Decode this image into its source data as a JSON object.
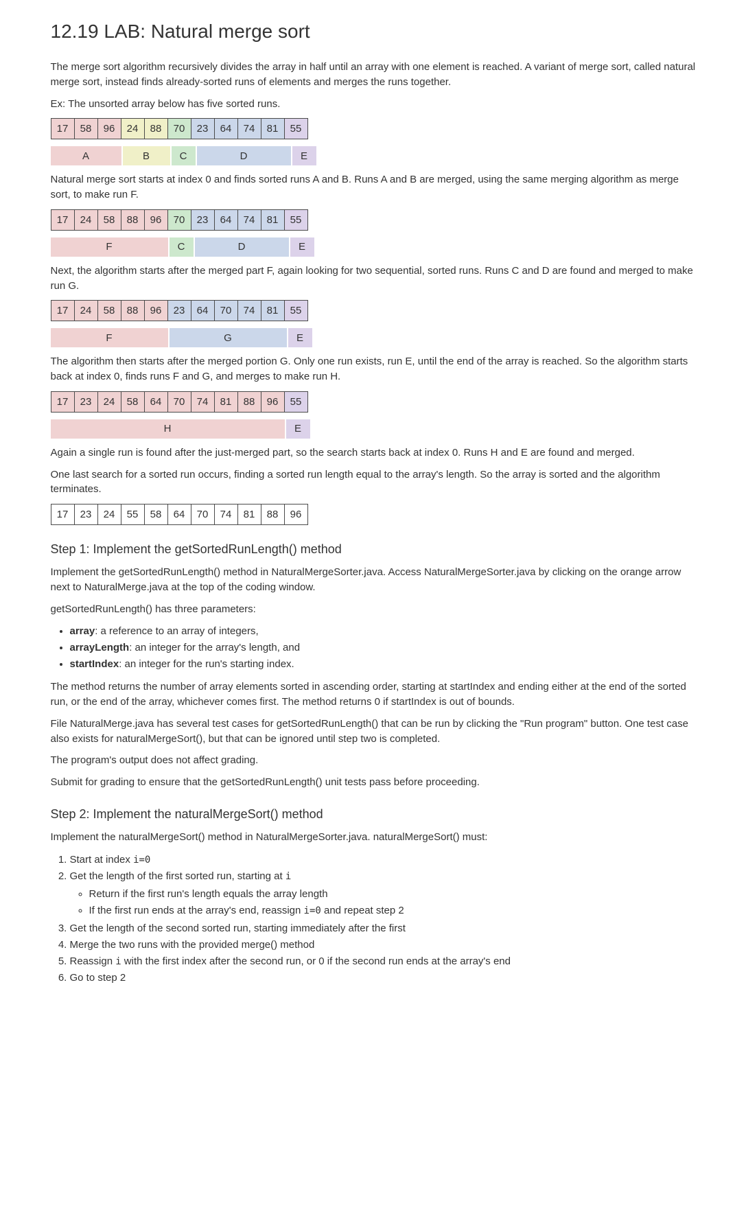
{
  "title": "12.19 LAB: Natural merge sort",
  "intro": "The merge sort algorithm recursively divides the array in half until an array with one element is reached. A variant of merge sort, called natural merge sort, instead finds already-sorted runs of elements and merges the runs together.",
  "ex_line": "Ex: The unsorted array below has five sorted runs.",
  "arr1": {
    "vals": [
      17,
      58,
      96,
      24,
      88,
      70,
      23,
      64,
      74,
      81,
      55
    ]
  },
  "labels1": [
    {
      "letter": "A",
      "span": 3,
      "color": "c-pink"
    },
    {
      "letter": "B",
      "span": 2,
      "color": "c-yellow"
    },
    {
      "letter": "C",
      "span": 1,
      "color": "c-green"
    },
    {
      "letter": "D",
      "span": 4,
      "color": "c-blue"
    },
    {
      "letter": "E",
      "span": 1,
      "color": "c-purple"
    }
  ],
  "p2": "Natural merge sort starts at index 0 and finds sorted runs A and B. Runs A and B are merged, using the same merging algorithm as merge sort, to make run F.",
  "arr2": {
    "vals": [
      17,
      24,
      58,
      88,
      96,
      70,
      23,
      64,
      74,
      81,
      55
    ]
  },
  "labels2": [
    {
      "letter": "F",
      "span": 5,
      "color": "c-pink"
    },
    {
      "letter": "C",
      "span": 1,
      "color": "c-green"
    },
    {
      "letter": "D",
      "span": 4,
      "color": "c-blue"
    },
    {
      "letter": "E",
      "span": 1,
      "color": "c-purple"
    }
  ],
  "p3": "Next, the algorithm starts after the merged part F, again looking for two sequential, sorted runs. Runs C and D are found and merged to make run G.",
  "arr3": {
    "vals": [
      17,
      24,
      58,
      88,
      96,
      23,
      64,
      70,
      74,
      81,
      55
    ]
  },
  "labels3": [
    {
      "letter": "F",
      "span": 5,
      "color": "c-pink"
    },
    {
      "letter": "G",
      "span": 5,
      "color": "c-blue"
    },
    {
      "letter": "E",
      "span": 1,
      "color": "c-purple"
    }
  ],
  "p4": "The algorithm then starts after the merged portion G. Only one run exists, run E, until the end of the array is reached. So the algorithm starts back at index 0, finds runs F and G, and merges to make run H.",
  "arr4": {
    "vals": [
      17,
      23,
      24,
      58,
      64,
      70,
      74,
      81,
      88,
      96,
      55
    ]
  },
  "labels4": [
    {
      "letter": "H",
      "span": 10,
      "color": "c-pink"
    },
    {
      "letter": "E",
      "span": 1,
      "color": "c-purple"
    }
  ],
  "p5": "Again a single run is found after the just-merged part, so the search starts back at index 0. Runs H and E are found and merged.",
  "p6": "One last search for a sorted run occurs, finding a sorted run length equal to the array's length. So the array is sorted and the algorithm terminates.",
  "arr5": {
    "vals": [
      17,
      23,
      24,
      55,
      58,
      64,
      70,
      74,
      81,
      88,
      96
    ]
  },
  "step1_h": "Step 1: Implement the getSortedRunLength() method",
  "step1_p1": "Implement the getSortedRunLength() method in NaturalMergeSorter.java. Access NaturalMergeSorter.java by clicking on the orange arrow next to NaturalMerge.java at the top of the coding window.",
  "step1_p2": "getSortedRunLength() has three parameters:",
  "step1_list": {
    "i1_b": "array",
    "i1": ": a reference to an array of integers,",
    "i2_b": "arrayLength",
    "i2": ": an integer for the array's length, and",
    "i3_b": "startIndex",
    "i3": ": an integer for the run's starting index."
  },
  "step1_p3": "The method returns the number of array elements sorted in ascending order, starting at startIndex and ending either at the end of the sorted run, or the end of the array, whichever comes first. The method returns 0 if startIndex is out of bounds.",
  "step1_p4": "File NaturalMerge.java has several test cases for getSortedRunLength() that can be run by clicking the \"Run program\" button. One test case also exists for naturalMergeSort(), but that can be ignored until step two is completed.",
  "step1_p5": "The program's output does not affect grading.",
  "step1_p6": "Submit for grading to ensure that the getSortedRunLength() unit tests pass before proceeding.",
  "step2_h": "Step 2: Implement the naturalMergeSort() method",
  "step2_p1": "Implement the naturalMergeSort() method in NaturalMergeSorter.java. naturalMergeSort() must:",
  "step2_list": {
    "i1a": "Start at index ",
    "i1b": "i=0",
    "i2a": "Get the length of the first sorted run, starting at ",
    "i2b": "i",
    "i2s1": "Return if the first run's length equals the array length",
    "i2s2a": "If the first run ends at the array's end, reassign ",
    "i2s2b": "i=0",
    "i2s2c": " and repeat step 2",
    "i3": "Get the length of the second sorted run, starting immediately after the first",
    "i4": "Merge the two runs with the provided merge() method",
    "i5a": "Reassign ",
    "i5b": "i",
    "i5c": " with the first index after the second run, or 0 if the second run ends at the array's end",
    "i6": "Go to step 2"
  },
  "cell_colors": {
    "r1": [
      "c-pink",
      "c-pink",
      "c-pink",
      "c-yellow",
      "c-yellow",
      "c-green",
      "c-blue",
      "c-blue",
      "c-blue",
      "c-blue",
      "c-purple"
    ],
    "r2": [
      "c-pink",
      "c-pink",
      "c-pink",
      "c-pink",
      "c-pink",
      "c-green",
      "c-blue",
      "c-blue",
      "c-blue",
      "c-blue",
      "c-purple"
    ],
    "r3": [
      "c-pink",
      "c-pink",
      "c-pink",
      "c-pink",
      "c-pink",
      "c-blue",
      "c-blue",
      "c-blue",
      "c-blue",
      "c-blue",
      "c-purple"
    ],
    "r4": [
      "c-pink",
      "c-pink",
      "c-pink",
      "c-pink",
      "c-pink",
      "c-pink",
      "c-pink",
      "c-pink",
      "c-pink",
      "c-pink",
      "c-purple"
    ],
    "r5": [
      "c-white",
      "c-white",
      "c-white",
      "c-white",
      "c-white",
      "c-white",
      "c-white",
      "c-white",
      "c-white",
      "c-white",
      "c-white"
    ]
  }
}
